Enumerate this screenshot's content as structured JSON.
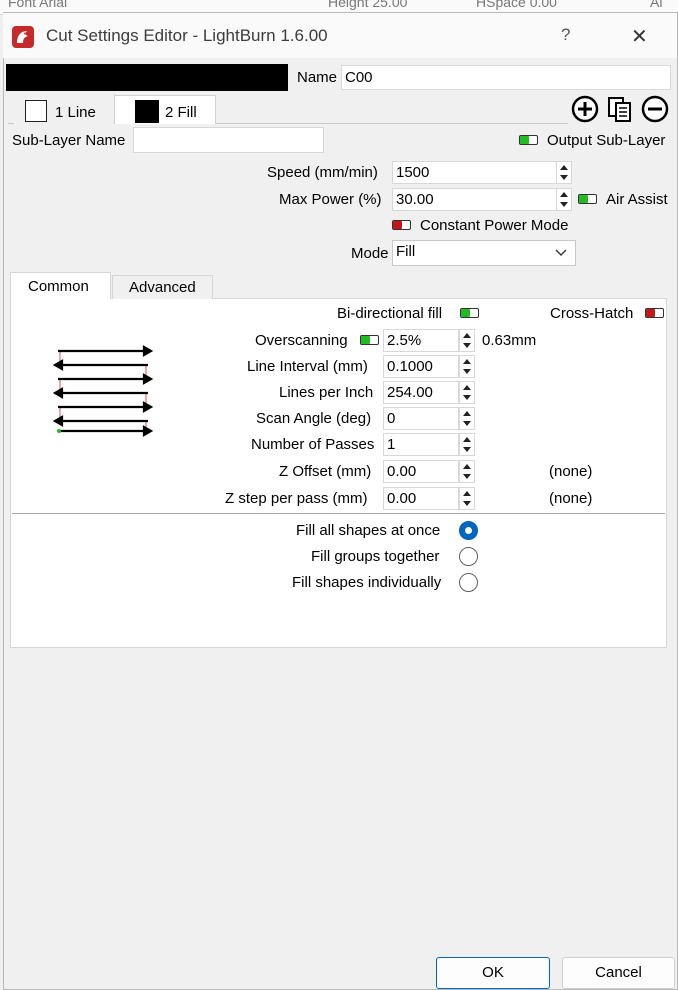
{
  "background": {
    "items": [
      "Font  Arial",
      "Height  25.00",
      "HSpace  0.00",
      "Al"
    ]
  },
  "window": {
    "title": "Cut Settings Editor - LightBurn 1.6.00",
    "help_glyph": "?",
    "close_glyph": "✕"
  },
  "name_row": {
    "label": "Name",
    "value": "C00",
    "color_swatch": "#000000"
  },
  "sublayer_tabs": [
    {
      "label": "1 Line",
      "swatch": "#ffffff"
    },
    {
      "label": "2 Fill",
      "swatch": "#000000"
    }
  ],
  "sublayer": {
    "name_label": "Sub-Layer Name",
    "name_value": "",
    "output_label": "Output Sub-Layer",
    "output_on": true
  },
  "speed": {
    "label": "Speed (mm/min)",
    "value": "1500"
  },
  "max_power": {
    "label": "Max Power (%)",
    "value": "30.00"
  },
  "air_assist": {
    "label": "Air Assist",
    "on": true
  },
  "constant_power": {
    "label": "Constant Power Mode",
    "on": false
  },
  "mode": {
    "label": "Mode",
    "value": "Fill"
  },
  "inner_tabs": [
    "Common",
    "Advanced"
  ],
  "fill": {
    "bidirectional_label": "Bi-directional fill",
    "bidirectional_on": true,
    "crosshatch_label": "Cross-Hatch",
    "crosshatch_on": false,
    "overscanning": {
      "label": "Overscanning",
      "on": true,
      "value": "2.5%",
      "unit_value": "0.63mm"
    },
    "line_interval": {
      "label": "Line Interval (mm)",
      "value": "0.1000"
    },
    "lines_per_inch": {
      "label": "Lines per Inch",
      "value": "254.00"
    },
    "scan_angle": {
      "label": "Scan Angle (deg)",
      "value": "0"
    },
    "passes": {
      "label": "Number of Passes",
      "value": "1"
    },
    "z_offset": {
      "label": "Z Offset (mm)",
      "value": "0.00",
      "note": "(none)"
    },
    "z_step": {
      "label": "Z step per pass (mm)",
      "value": "0.00",
      "note": "(none)"
    }
  },
  "fill_grouping": {
    "options": [
      "Fill all shapes at once",
      "Fill groups together",
      "Fill shapes individually"
    ],
    "selected": 0
  },
  "buttons": {
    "ok": "OK",
    "cancel": "Cancel"
  },
  "colors": {
    "toggle_on": "#22bb22",
    "toggle_off": "#c01818",
    "accent": "#0067c0",
    "arrow_tip": "#e26a6a",
    "start_dot": "#22bb22"
  }
}
